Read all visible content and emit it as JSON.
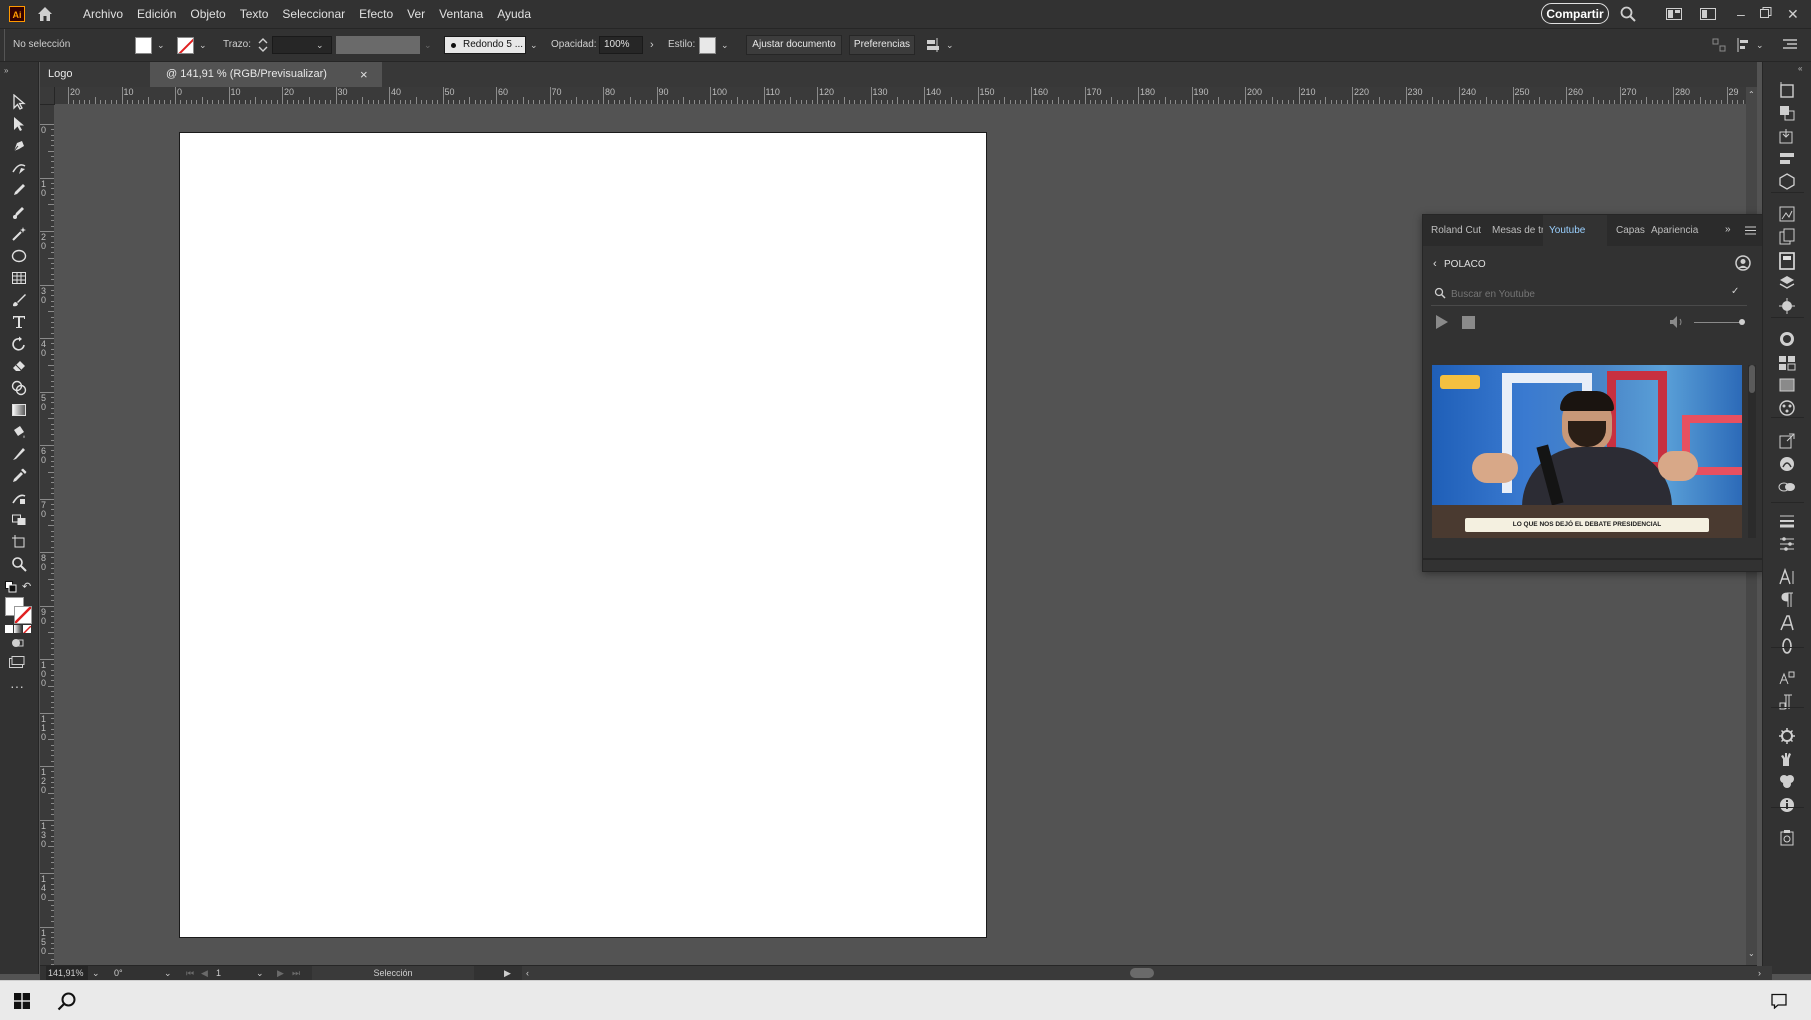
{
  "app": {
    "logo": "Ai",
    "menu": [
      "Archivo",
      "Edición",
      "Objeto",
      "Texto",
      "Seleccionar",
      "Efecto",
      "Ver",
      "Ventana",
      "Ayuda"
    ],
    "share": "Compartir"
  },
  "control": {
    "selection": "No selección",
    "stroke_label": "Trazo:",
    "brush": "Redondo 5 ...",
    "opacity_label": "Opacidad:",
    "opacity_value": "100%",
    "style_label": "Estilo:",
    "adjust_btn": "Ajustar documento",
    "prefs_btn": "Preferencias"
  },
  "tabs": {
    "left": "Logo",
    "doc": "@ 141,91 % (RGB/Previsualizar)",
    "close": "×"
  },
  "ruler": {
    "top": [
      "20",
      "10",
      "0",
      "10",
      "20",
      "30",
      "40",
      "50",
      "60",
      "70",
      "80",
      "90",
      "100",
      "110",
      "120",
      "130",
      "140",
      "150",
      "160",
      "170",
      "180",
      "190",
      "200",
      "210",
      "220",
      "230",
      "240",
      "250",
      "260",
      "270",
      "280",
      "29"
    ],
    "left": [
      "0",
      "10",
      "20",
      "30",
      "40",
      "50",
      "60",
      "70",
      "80",
      "90",
      "100",
      "110",
      "120",
      "130",
      "140",
      "150"
    ]
  },
  "panel": {
    "tabs": [
      "Roland Cut",
      "Mesas de tr",
      "Youtube",
      "Capas",
      "Apariencia"
    ],
    "back_label": "POLACO",
    "search_placeholder": "Buscar en Youtube",
    "video_caption": "LO QUE NOS DEJÓ EL DEBATE PRESIDENCIAL"
  },
  "status": {
    "zoom": "141,91%",
    "rotation": "0°",
    "artboard_num": "1",
    "tool": "Selección"
  },
  "colors": {
    "ui_dark": "#323232",
    "canvas": "#535353",
    "artboard": "#ffffff",
    "accent_orange": "#ff9a00",
    "none_red": "#e02020"
  }
}
